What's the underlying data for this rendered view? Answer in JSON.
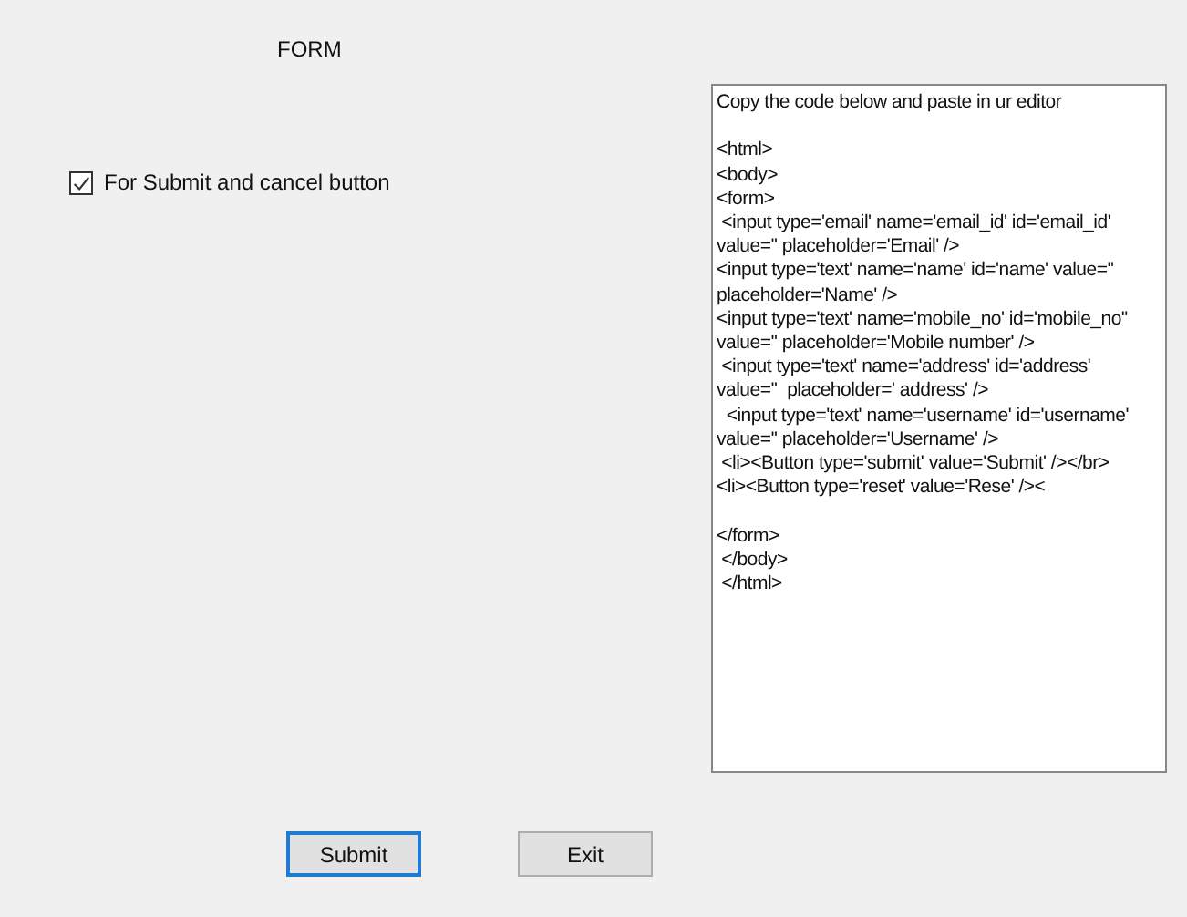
{
  "form_title": "FORM",
  "checkbox": {
    "label": "For Submit and cancel button",
    "checked": true
  },
  "code_box": {
    "text": "Copy the code below and paste in ur editor\n\n<html>\n<body>\n<form>\n <input type='email' name='email_id' id='email_id'\nvalue='' placeholder='Email' />\n<input type='text' name='name' id='name' value=''\nplaceholder='Name' />\n<input type='text' name='mobile_no' id='mobile_no''\nvalue='' placeholder='Mobile number' />\n <input type='text' name='address' id='address'\nvalue=''  placeholder=' address' />\n  <input type='text' name='username' id='username'\nvalue='' placeholder='Username' />\n <li><Button type='submit' value='Submit' /></br>\n<li><Button type='reset' value='Rese' /><\n\n</form>\n </body>\n </html>"
  },
  "buttons": [
    {
      "label": "Submit",
      "selected": true
    },
    {
      "label": "Exit",
      "selected": false
    }
  ]
}
